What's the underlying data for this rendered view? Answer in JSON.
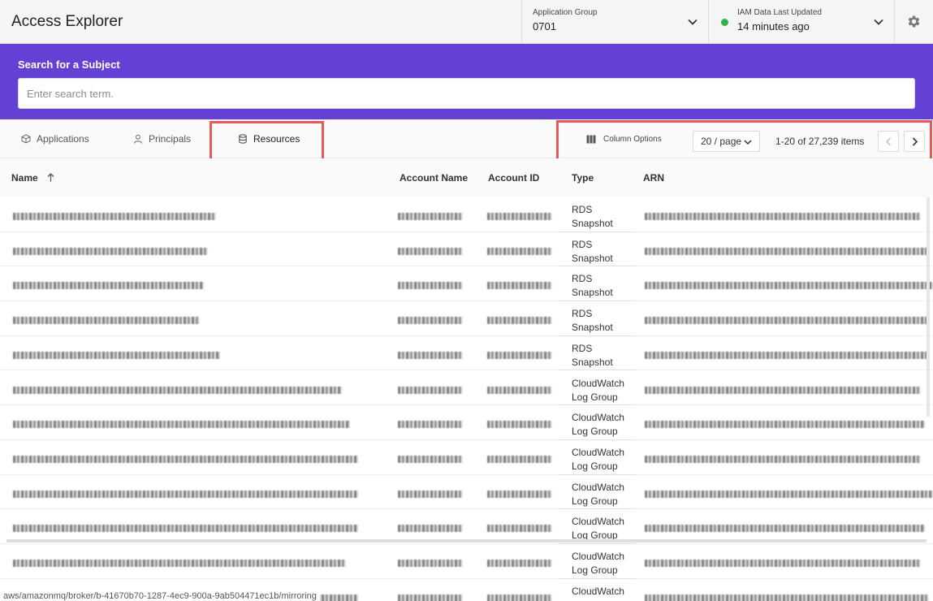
{
  "header": {
    "title": "Access Explorer",
    "app_group": {
      "label": "Application Group",
      "value": "0701"
    },
    "iam": {
      "label": "IAM Data Last Updated",
      "value": "14 minutes ago",
      "status_color": "#2fb344"
    }
  },
  "search": {
    "title": "Search for a Subject",
    "placeholder": "Enter search term.",
    "band_color": "#6440d4"
  },
  "tabs": [
    {
      "label": "Applications",
      "icon": "cube-icon"
    },
    {
      "label": "Principals",
      "icon": "user-icon"
    },
    {
      "label": "Resources",
      "icon": "database-icon",
      "active": true
    }
  ],
  "toolbar": {
    "column_options_label": "Column Options",
    "page_size": "20 / page",
    "page_info": "1-20 of 27,239 items"
  },
  "table": {
    "columns": [
      "Name",
      "Account Name",
      "Account ID",
      "Type",
      "ARN"
    ],
    "sort": {
      "column": "Name",
      "direction": "ascending"
    },
    "rows": [
      {
        "type": "RDS Snapshot"
      },
      {
        "type": "RDS Snapshot"
      },
      {
        "type": "RDS Snapshot"
      },
      {
        "type": "RDS Snapshot"
      },
      {
        "type": "RDS Snapshot"
      },
      {
        "type": "CloudWatch Log Group"
      },
      {
        "type": "CloudWatch Log Group"
      },
      {
        "type": "CloudWatch Log Group"
      },
      {
        "type": "CloudWatch Log Group"
      },
      {
        "type": "CloudWatch Log Group"
      },
      {
        "type": "CloudWatch Log Group"
      },
      {
        "type": "CloudWatch Log Group"
      }
    ]
  },
  "status_bar": "aws/amazonmq/broker/b-41670b70-1287-4ec9-900a-9ab504471ec1b/mirroring",
  "highlight_color": "#e85a5a"
}
